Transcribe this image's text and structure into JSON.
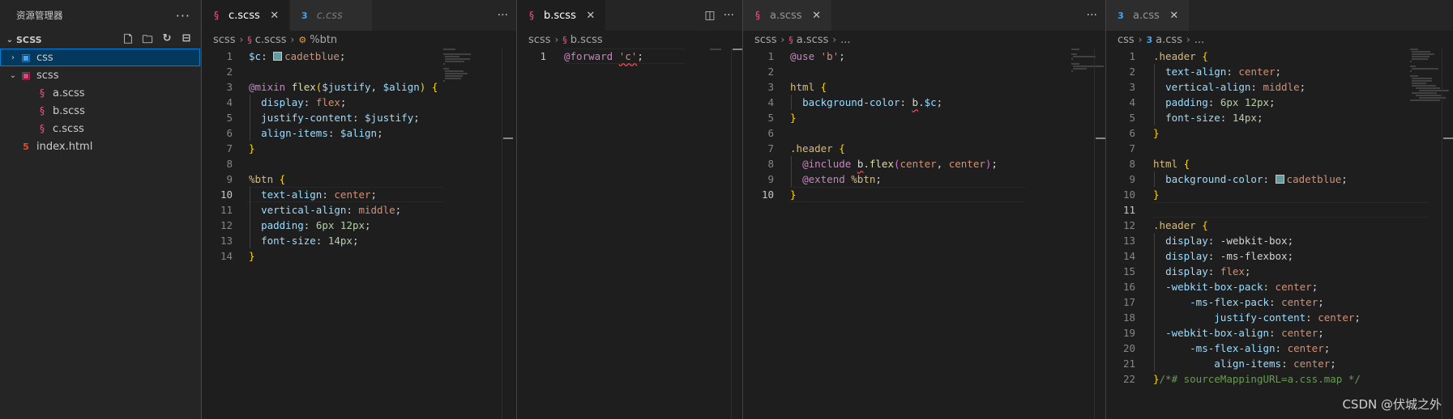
{
  "explorer": {
    "title": "资源管理器",
    "more": "···",
    "section": "SCSS",
    "items": [
      {
        "label": "css",
        "kind": "folder-css",
        "indent": 1,
        "twisty": "›",
        "selected": true
      },
      {
        "label": "scss",
        "kind": "folder-sass",
        "indent": 1,
        "twisty": "⌄",
        "selected": false
      },
      {
        "label": "a.scss",
        "kind": "sass",
        "indent": 2,
        "twisty": "",
        "selected": false
      },
      {
        "label": "b.scss",
        "kind": "sass",
        "indent": 2,
        "twisty": "",
        "selected": false
      },
      {
        "label": "c.scss",
        "kind": "sass",
        "indent": 2,
        "twisty": "",
        "selected": false
      },
      {
        "label": "index.html",
        "kind": "html",
        "indent": 1,
        "twisty": "",
        "selected": false
      }
    ]
  },
  "groups": [
    {
      "tabs": [
        {
          "label": "c.scss",
          "icon": "sass",
          "active": true,
          "preview": false,
          "close": "✕"
        },
        {
          "label": "c.css",
          "icon": "css",
          "active": false,
          "preview": true,
          "close": ""
        }
      ],
      "breadcrumb": [
        "scss",
        "c.scss",
        "%btn"
      ],
      "lines": [
        "<span class=\"var\">$c</span><span class=\"pl\">: </span><span class=\"swatch\"></span><span class=\"val\">cadetblue</span><span class=\"pl\">;</span>",
        "",
        "<span class=\"kw\">@mixin</span><span class=\"pl\"> </span><span class=\"fn\">flex</span><span class=\"br1\">(</span><span class=\"var\">$justify</span><span class=\"pl\">, </span><span class=\"var\">$align</span><span class=\"br1\">)</span><span class=\"pl\"> </span><span class=\"br1\">{</span>",
        "  <span class=\"prop\">display</span><span class=\"pl\">: </span><span class=\"val\">flex</span><span class=\"pl\">;</span>",
        "  <span class=\"prop\">justify-content</span><span class=\"pl\">: </span><span class=\"var\">$justify</span><span class=\"pl\">;</span>",
        "  <span class=\"prop\">align-items</span><span class=\"pl\">: </span><span class=\"var\">$align</span><span class=\"pl\">;</span>",
        "<span class=\"br1\">}</span>",
        "",
        "<span class=\"sel\">%btn</span><span class=\"pl\"> </span><span class=\"br1\">{</span>",
        "  <span class=\"prop\">text-align</span><span class=\"pl\">: </span><span class=\"val\">center</span><span class=\"pl\">;</span>",
        "  <span class=\"prop\">vertical-align</span><span class=\"pl\">: </span><span class=\"val\">middle</span><span class=\"pl\">;</span>",
        "  <span class=\"prop\">padding</span><span class=\"pl\">: </span><span class=\"num\">6px</span><span class=\"pl\"> </span><span class=\"num\">12px</span><span class=\"pl\">;</span>",
        "  <span class=\"prop\">font-size</span><span class=\"pl\">: </span><span class=\"num\">14px</span><span class=\"pl\">;</span>",
        "<span class=\"br1\">}</span>"
      ],
      "current_line": 10
    },
    {
      "tabs": [
        {
          "label": "b.scss",
          "icon": "sass",
          "active": true,
          "preview": false,
          "close": "✕"
        }
      ],
      "actions": [
        "◫",
        "···"
      ],
      "breadcrumb": [
        "scss",
        "b.scss"
      ],
      "lines": [
        "<span class=\"kw\">@forward</span><span class=\"pl\"> </span><span class=\"str squig\">'c'</span><span class=\"pl\">;</span>"
      ],
      "current_line": 1
    },
    {
      "tabs": [
        {
          "label": "a.scss",
          "icon": "sass",
          "active": false,
          "preview": false,
          "close": "✕"
        }
      ],
      "actions": [
        "···"
      ],
      "breadcrumb": [
        "scss",
        "a.scss",
        "..."
      ],
      "lines": [
        "<span class=\"kw\">@use</span><span class=\"pl\"> </span><span class=\"str\">'b'</span><span class=\"pl\">;</span>",
        "",
        "<span class=\"sel\">html</span><span class=\"pl\"> </span><span class=\"br1\">{</span>",
        "  <span class=\"prop\">background-color</span><span class=\"pl\">: </span><span class=\"pl squig\">b</span><span class=\"pl\">.</span><span class=\"var\">$c</span><span class=\"pl\">;</span>",
        "<span class=\"br1\">}</span>",
        "",
        "<span class=\"sel\">.header</span><span class=\"pl\"> </span><span class=\"br1\">{</span>",
        "  <span class=\"kw\">@include</span><span class=\"pl\"> </span><span class=\"pl squig\">b</span><span class=\"pl\">.</span><span class=\"fn\">flex</span><span class=\"br2\">(</span><span class=\"val\">center</span><span class=\"pl\">, </span><span class=\"val\">center</span><span class=\"br2\">)</span><span class=\"pl\">;</span>",
        "  <span class=\"kw\">@extend</span><span class=\"pl\"> </span><span class=\"sel\">%btn</span><span class=\"pl\">;</span>",
        "<span class=\"br1\">}</span>"
      ],
      "current_line": 10
    },
    {
      "tabs": [
        {
          "label": "a.css",
          "icon": "css",
          "active": false,
          "preview": false,
          "close": "✕"
        }
      ],
      "actions": [],
      "breadcrumb": [
        "css",
        "a.css",
        "..."
      ],
      "lines": [
        "<span class=\"sel\">.header</span><span class=\"pl\"> </span><span class=\"br1\">{</span>",
        "  <span class=\"prop\">text-align</span><span class=\"pl\">: </span><span class=\"val\">center</span><span class=\"pl\">;</span>",
        "  <span class=\"prop\">vertical-align</span><span class=\"pl\">: </span><span class=\"val\">middle</span><span class=\"pl\">;</span>",
        "  <span class=\"prop\">padding</span><span class=\"pl\">: </span><span class=\"num\">6px</span><span class=\"pl\"> </span><span class=\"num\">12px</span><span class=\"pl\">;</span>",
        "  <span class=\"prop\">font-size</span><span class=\"pl\">: </span><span class=\"num\">14px</span><span class=\"pl\">;</span>",
        "<span class=\"br1\">}</span>",
        "",
        "<span class=\"sel\">html</span><span class=\"pl\"> </span><span class=\"br1\">{</span>",
        "  <span class=\"prop\">background-color</span><span class=\"pl\">: </span><span class=\"swatch\"></span><span class=\"val\">cadetblue</span><span class=\"pl\">;</span>",
        "<span class=\"br1\">}</span>",
        "",
        "<span class=\"sel\">.header</span><span class=\"pl\"> </span><span class=\"br1\">{</span>",
        "  <span class=\"prop\">display</span><span class=\"pl\">: -webkit-box;</span>",
        "  <span class=\"prop\">display</span><span class=\"pl\">: -ms-flexbox;</span>",
        "  <span class=\"prop\">display</span><span class=\"pl\">: </span><span class=\"val\">flex</span><span class=\"pl\">;</span>",
        "  <span class=\"prop\">-webkit-box-pack</span><span class=\"pl\">: </span><span class=\"val\">center</span><span class=\"pl\">;</span>",
        "      <span class=\"prop\">-ms-flex-pack</span><span class=\"pl\">: </span><span class=\"val\">center</span><span class=\"pl\">;</span>",
        "          <span class=\"prop\">justify-content</span><span class=\"pl\">: </span><span class=\"val\">center</span><span class=\"pl\">;</span>",
        "  <span class=\"prop\">-webkit-box-align</span><span class=\"pl\">: </span><span class=\"val\">center</span><span class=\"pl\">;</span>",
        "      <span class=\"prop\">-ms-flex-align</span><span class=\"pl\">: </span><span class=\"val\">center</span><span class=\"pl\">;</span>",
        "          <span class=\"prop\">align-items</span><span class=\"pl\">: </span><span class=\"val\">center</span><span class=\"pl\">;</span>",
        "<span class=\"br1\">}</span><span class=\"cmt\">/*# sourceMappingURL=a.css.map */</span>"
      ],
      "current_line": 11
    }
  ],
  "watermark": "CSDN @伏城之外",
  "colors": {
    "background": "#1e1e1e",
    "sidebar": "#252526",
    "selection": "#04395e",
    "focus_border": "#007fd4"
  }
}
